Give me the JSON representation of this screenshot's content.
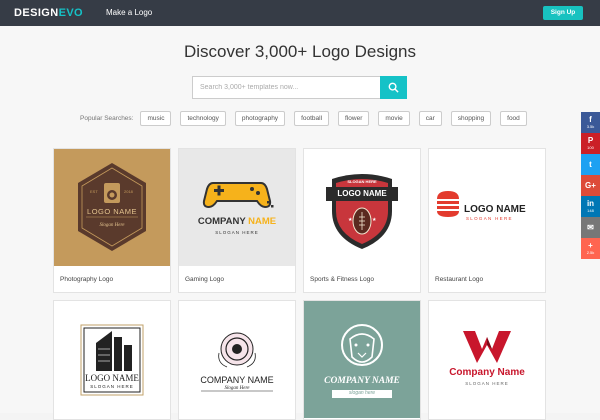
{
  "header": {
    "brand_part1": "DESIGN",
    "brand_part2": "EVO",
    "nav_make_logo": "Make a Logo",
    "signup_label": "Sign Up"
  },
  "main": {
    "title": "Discover 3,000+ Logo Designs",
    "search_placeholder": "Search 3,000+ templates now...",
    "popular_label": "Popular Searches:",
    "tags": [
      "music",
      "technology",
      "photography",
      "football",
      "flower",
      "movie",
      "car",
      "shopping",
      "food"
    ]
  },
  "cards": [
    {
      "caption": "Photography Logo",
      "logo_text": "LOGO NAME",
      "logo_sub": "Slogan Here",
      "badge_left": "EST",
      "badge_right": "2018"
    },
    {
      "caption": "Gaming Logo",
      "logo_text1": "COMPANY",
      "logo_text2": "NAME",
      "logo_sub": "SLOGAN HERE"
    },
    {
      "caption": "Sports & Fitness Logo",
      "logo_top": "SLOGAN HERE",
      "logo_text": "LOGO NAME"
    },
    {
      "caption": "Restaurant Logo",
      "logo_text": "LOGO NAME",
      "logo_sub": "SLOGAN HERE"
    },
    {
      "caption": "",
      "logo_text": "LOGO NAME",
      "logo_sub": "SLOGAN HERE"
    },
    {
      "caption": "",
      "logo_text": "COMPANY NAME",
      "logo_sub": "Slogan Here"
    },
    {
      "caption": "",
      "logo_text": "COMPANY NAME",
      "logo_sub": "slogan here"
    },
    {
      "caption": "",
      "logo_text": "Company Name",
      "logo_sub": "SLOGAN HERE"
    }
  ],
  "social": [
    {
      "name": "facebook",
      "glyph": "f",
      "count": "3.5k",
      "color": "#3b5998"
    },
    {
      "name": "pinterest",
      "glyph": "P",
      "count": "100",
      "color": "#cb2027"
    },
    {
      "name": "twitter",
      "glyph": "t",
      "count": "",
      "color": "#1da1f2"
    },
    {
      "name": "google-plus",
      "glyph": "G+",
      "count": "",
      "color": "#dd4b39"
    },
    {
      "name": "linkedin",
      "glyph": "in",
      "count": "148",
      "color": "#0077b5"
    },
    {
      "name": "email",
      "glyph": "✉",
      "count": "",
      "color": "#777777"
    },
    {
      "name": "share",
      "glyph": "+",
      "count": "2.5k",
      "color": "#ff6550"
    }
  ],
  "colors": {
    "accent": "#15c2c7",
    "topbar": "#363c46"
  }
}
